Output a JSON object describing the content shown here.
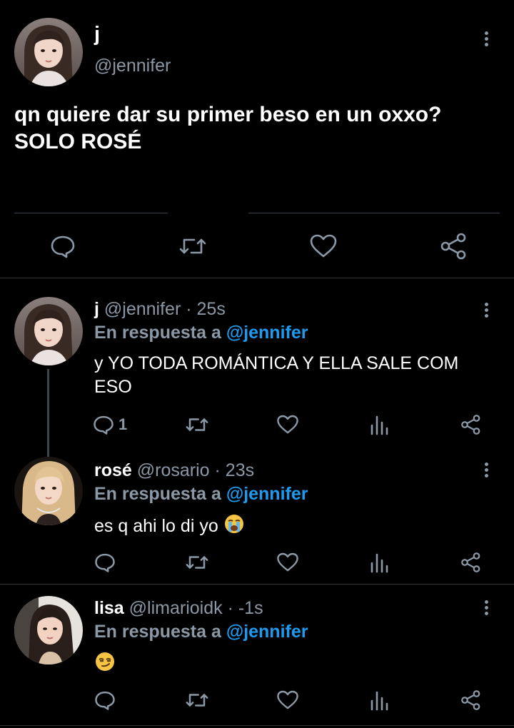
{
  "main_tweet": {
    "author_name": "j",
    "author_handle": "@jennifer",
    "text_line1": "qn quiere dar su primer beso en un oxxo?",
    "text_line2": "SOLO ROSÉ",
    "actions": [
      "reply-icon",
      "retweet-icon",
      "like-icon",
      "share-icon"
    ]
  },
  "replies": [
    {
      "name": "j",
      "handle": "@jennifer",
      "time": "· 25s",
      "in_reply_prefix": "En respuesta a ",
      "in_reply_mention": "@jennifer",
      "text_line1": "y YO TODA ROMÁNTICA Y ELLA SALE COM",
      "text_line2": "ESO",
      "reply_count": "1"
    },
    {
      "name": "rosé",
      "handle": "@rosario",
      "time": "· 23s",
      "in_reply_prefix": "En respuesta a ",
      "in_reply_mention": "@jennifer",
      "text": "es q ahi lo di yo",
      "emoji": "loudly-crying-face",
      "reply_count": ""
    },
    {
      "name": "lisa",
      "handle": "@limarioidk",
      "time": "· -1s",
      "in_reply_prefix": "En respuesta a ",
      "in_reply_mention": "@jennifer",
      "text": "",
      "emoji": "smirking-face",
      "reply_count": ""
    }
  ],
  "colors": {
    "background": "#000000",
    "text_primary": "#ffffff",
    "text_secondary": "#8b98a5",
    "mention": "#1d9bf0",
    "divider": "#2f3336"
  }
}
